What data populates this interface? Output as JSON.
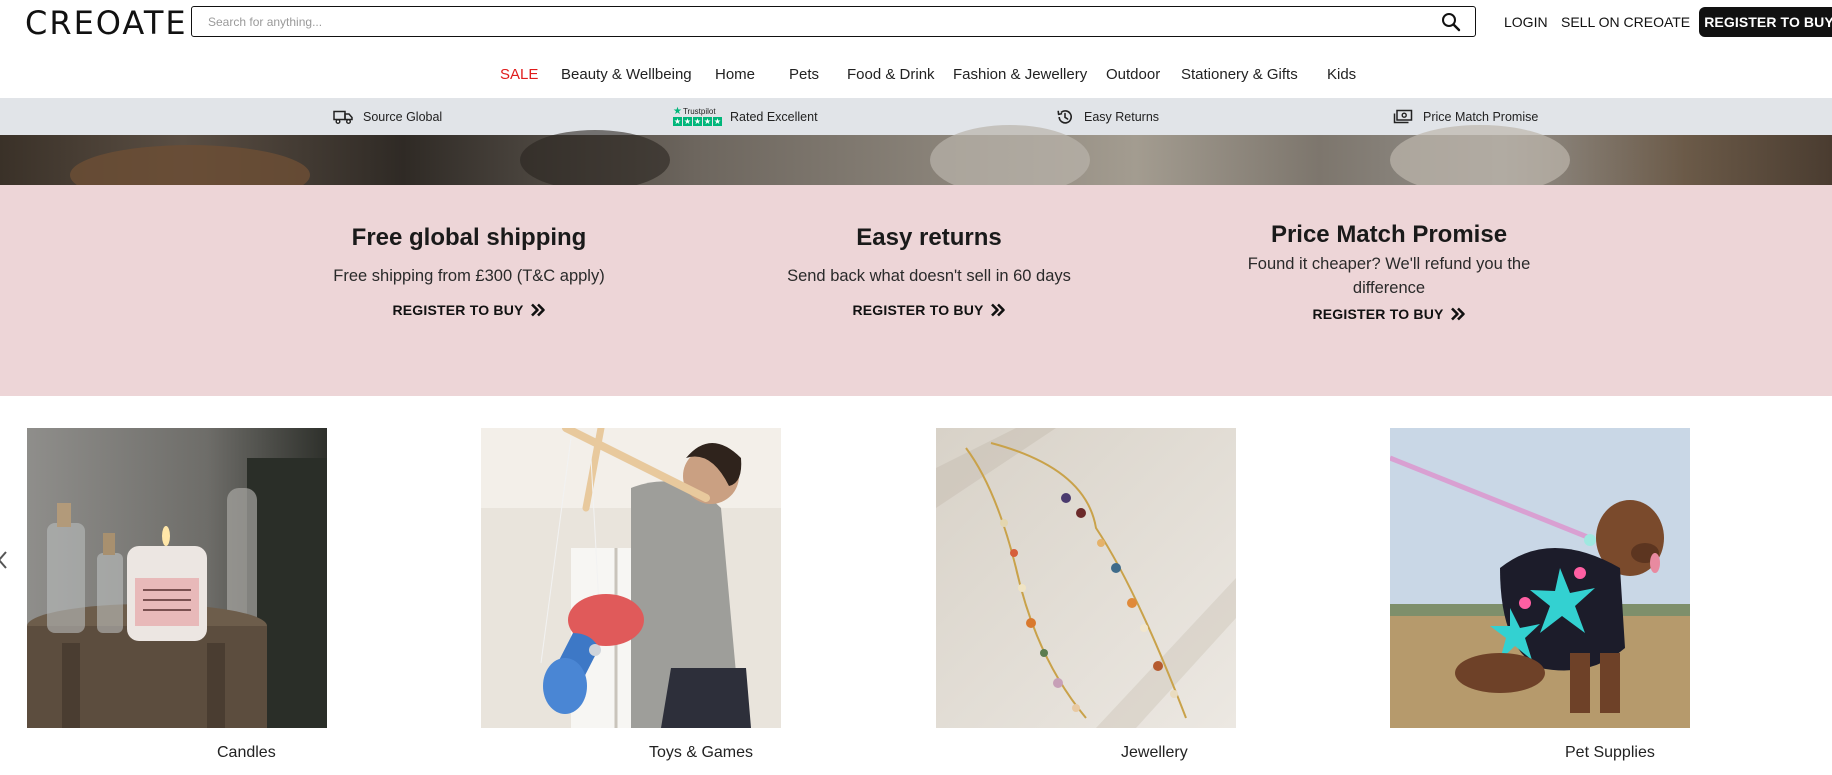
{
  "header": {
    "logo": "CREOATE",
    "search_placeholder": "Search for anything...",
    "login": "LOGIN",
    "sell": "SELL ON CREOATE",
    "register": "REGISTER TO BUY"
  },
  "nav": [
    {
      "label": "SALE"
    },
    {
      "label": "Beauty & Wellbeing"
    },
    {
      "label": "Home"
    },
    {
      "label": "Pets"
    },
    {
      "label": "Food & Drink"
    },
    {
      "label": "Fashion & Jewellery"
    },
    {
      "label": "Outdoor"
    },
    {
      "label": "Stationery & Gifts"
    },
    {
      "label": "Kids"
    }
  ],
  "usp": {
    "source_global": "Source Global",
    "trustpilot": "Trustpilot",
    "rated_excellent": "Rated Excellent",
    "easy_returns": "Easy Returns",
    "price_match": "Price Match Promise"
  },
  "promo": [
    {
      "title": "Free global shipping",
      "text": "Free shipping from £300 (T&C apply)",
      "cta": "REGISTER TO BUY"
    },
    {
      "title": "Easy returns",
      "text": "Send back what doesn't sell in 60 days",
      "cta": "REGISTER TO BUY"
    },
    {
      "title": "Price Match Promise",
      "text": "Found it cheaper? We'll refund you the difference",
      "cta": "REGISTER TO BUY"
    }
  ],
  "categories": [
    {
      "label": "Candles",
      "icon": "candle-photo"
    },
    {
      "label": "Toys & Games",
      "icon": "diabolo-photo"
    },
    {
      "label": "Jewellery",
      "icon": "necklace-photo"
    },
    {
      "label": "Pet Supplies",
      "icon": "dog-photo"
    }
  ],
  "colors": {
    "sale": "#e01b1b",
    "usp_bar": "#e1e4e8",
    "promo_band": "#edd5d7",
    "button": "#111111",
    "trustpilot_green": "#00b67a"
  }
}
